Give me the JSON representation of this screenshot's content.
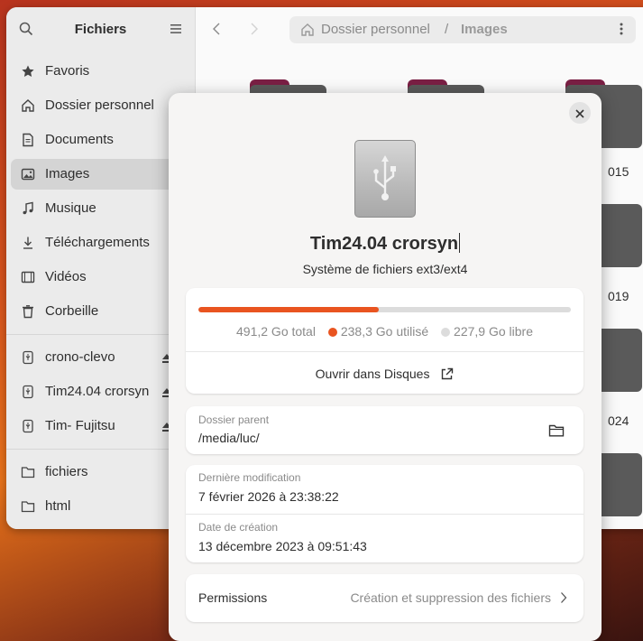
{
  "sidebar": {
    "title": "Fichiers",
    "places": [
      {
        "label": "Favoris",
        "icon": "star-icon"
      },
      {
        "label": "Dossier personnel",
        "icon": "home-icon"
      },
      {
        "label": "Documents",
        "icon": "document-icon"
      },
      {
        "label": "Images",
        "icon": "image-icon",
        "selected": true
      },
      {
        "label": "Musique",
        "icon": "music-icon"
      },
      {
        "label": "Téléchargements",
        "icon": "download-icon"
      },
      {
        "label": "Vidéos",
        "icon": "video-icon"
      },
      {
        "label": "Corbeille",
        "icon": "trash-icon"
      }
    ],
    "devices": [
      {
        "label": "crono-clevo",
        "icon": "usb-drive-icon"
      },
      {
        "label": "Tim24.04 crorsyn",
        "icon": "usb-drive-icon"
      },
      {
        "label": "Tim- Fujitsu",
        "icon": "usb-drive-icon"
      }
    ],
    "bookmarks": [
      {
        "label": "fichiers",
        "icon": "folder-icon"
      },
      {
        "label": "html",
        "icon": "folder-icon"
      }
    ]
  },
  "pathbar": {
    "home": "Dossier personnel",
    "separator": "/",
    "current": "Images"
  },
  "background_folders": [
    {
      "label": "015"
    },
    {
      "label": "019"
    },
    {
      "label": "024"
    }
  ],
  "dialog": {
    "name": "Tim24.04 crorsyn",
    "filesystem": "Système de fichiers ext3/ext4",
    "usage": {
      "total": "491,2 Go total",
      "used": "238,3 Go utilisé",
      "free": "227,9 Go libre",
      "used_fraction": 0.485,
      "used_color": "#e95420",
      "free_color": "#dcdcdc"
    },
    "open_disks": "Ouvrir dans Disques",
    "parent": {
      "label": "Dossier parent",
      "value": "/media/luc/"
    },
    "modified": {
      "label": "Dernière modification",
      "value": "7 février 2026 à 23:38:22"
    },
    "created": {
      "label": "Date de création",
      "value": "13 décembre 2023 à 09:51:43"
    },
    "permissions": {
      "label": "Permissions",
      "value": "Création et suppression des fichiers"
    }
  }
}
